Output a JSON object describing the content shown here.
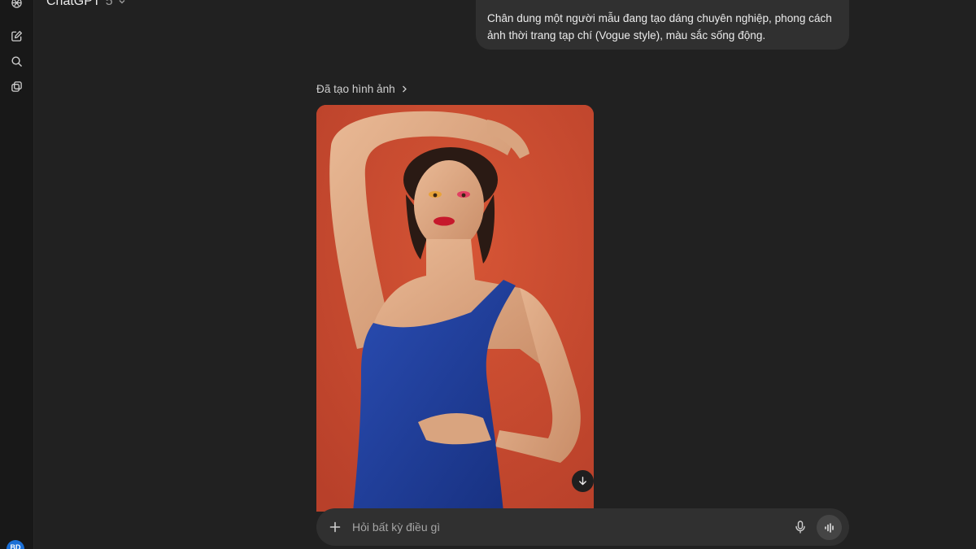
{
  "sidebar": {
    "logo_icon": "openai-logo-icon",
    "items": [
      {
        "icon": "new-chat-icon"
      },
      {
        "icon": "search-icon"
      },
      {
        "icon": "library-icon"
      }
    ],
    "avatar_initials": "BD"
  },
  "header": {
    "model_name": "ChatGPT",
    "model_version": "5"
  },
  "conversation": {
    "user_message": "Chân dung một người mẫu đang tạo dáng chuyên nghiệp, phong cách ảnh thời trang tạp chí (Vogue style), màu sắc sống động.",
    "generated_caption": "Đã tạo hình ảnh",
    "image_download_icon": "download-icon"
  },
  "composer": {
    "placeholder": "Hỏi bất kỳ điều gì",
    "value": ""
  },
  "colors": {
    "background": "#212121",
    "sidebar": "#181818",
    "bubble": "#303030",
    "avatar": "#1b6fd6",
    "image_backdrop": "#c94a2e",
    "dress": "#1f3f9e"
  }
}
